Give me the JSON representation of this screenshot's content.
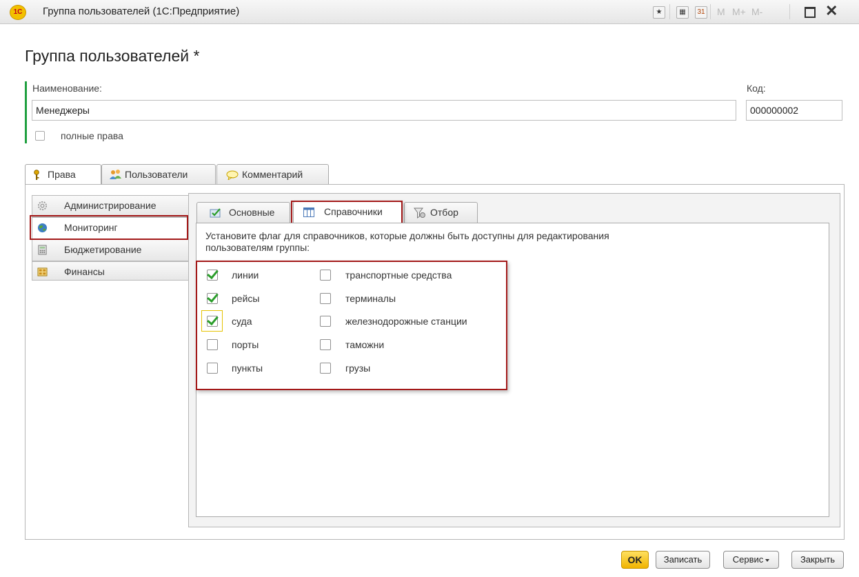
{
  "window": {
    "title": "Группа пользователей  (1С:Предприятие)",
    "logo_text": "1С",
    "memory_buttons": [
      "M",
      "M+",
      "M-"
    ],
    "calendar_day": "31"
  },
  "form": {
    "title": "Группа пользователей *",
    "name_label": "Наименование:",
    "name_value": "Менеджеры",
    "code_label": "Код:",
    "code_value": "000000002",
    "full_rights_label": "полные права",
    "full_rights_checked": false
  },
  "tabs": [
    {
      "label": "Права",
      "icon": "key-icon",
      "active": true
    },
    {
      "label": "Пользователи",
      "icon": "users-icon",
      "active": false
    },
    {
      "label": "Комментарий",
      "icon": "comment-icon",
      "active": false
    }
  ],
  "sidebar": {
    "items": [
      {
        "label": "Администрирование",
        "icon": "gear-icon",
        "active": false
      },
      {
        "label": "Мониторинг",
        "icon": "globe-icon",
        "active": true
      },
      {
        "label": "Бюджетирование",
        "icon": "calculator-icon",
        "active": false
      },
      {
        "label": "Финансы",
        "icon": "finance-icon",
        "active": false
      }
    ]
  },
  "subtabs": [
    {
      "label": "Основные",
      "icon": "checklist-icon",
      "active": false
    },
    {
      "label": "Справочники",
      "icon": "table-icon",
      "active": true
    },
    {
      "label": "Отбор",
      "icon": "filter-icon",
      "active": false
    }
  ],
  "instruction": {
    "line1": "Установите флаг для справочников, которые должны быть доступны для редактирования",
    "line2": "пользователям группы:"
  },
  "checkboxes": {
    "left": [
      {
        "label": "линии",
        "checked": true
      },
      {
        "label": "рейсы",
        "checked": true
      },
      {
        "label": "суда",
        "checked": true,
        "focused": true
      },
      {
        "label": "порты",
        "checked": false
      },
      {
        "label": "пункты",
        "checked": false
      }
    ],
    "right": [
      {
        "label": "транспортные средства",
        "checked": false
      },
      {
        "label": "терминалы",
        "checked": false
      },
      {
        "label": "железнодорожные станции",
        "checked": false
      },
      {
        "label": "таможни",
        "checked": false
      },
      {
        "label": "грузы",
        "checked": false
      }
    ]
  },
  "buttons": {
    "ok": "OK",
    "save": "Записать",
    "service": "Сервис",
    "close": "Закрыть"
  },
  "colors": {
    "accent_red": "#a31818",
    "required_bar": "#20a040",
    "ok_button": "#f0b400",
    "check_mark": "#2a9d2a"
  }
}
